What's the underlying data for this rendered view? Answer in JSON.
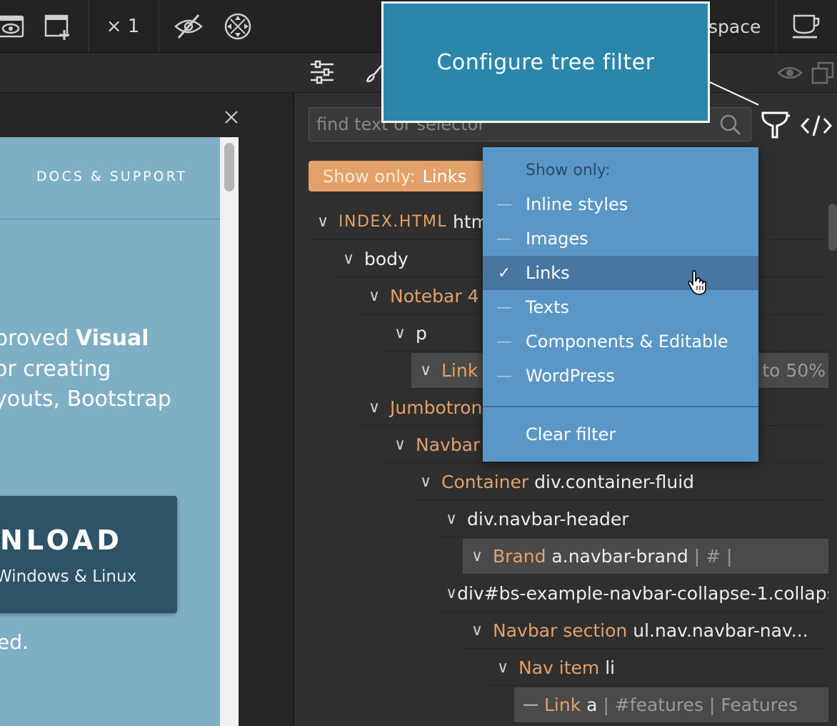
{
  "toolbar": {
    "zoom_label": "× 1",
    "workspace_label": "space"
  },
  "tooltip": {
    "text": "Configure tree filter"
  },
  "preview": {
    "docs_label": "DOCS & SUPPORT",
    "hero_line1_prefix": "proved ",
    "hero_line1_bold": "Visual",
    "hero_line2": "or creating",
    "hero_line3": "youts, Bootstrap",
    "download_label": "NLOAD",
    "download_sub": "Windows & Linux",
    "footer_text": "ed."
  },
  "search": {
    "placeholder": "find text or selector"
  },
  "filter_pill": {
    "key": "Show only:",
    "value": "Links"
  },
  "tree": {
    "root_name": "INDEX.HTML",
    "root_tag": "htm",
    "body": "body",
    "notebar_name": "Notebar 4",
    "p_tag": "p",
    "link1_name": "Link",
    "link1_trail": "p to 50%",
    "jumbotron_name": "Jumbotron",
    "navbar_name": "Navbar",
    "container_name": "Container",
    "container_tag": "div.container-fluid",
    "navbar_header": "div.navbar-header",
    "brand_name": "Brand",
    "brand_tag": "a.navbar-brand",
    "brand_sep1": "|",
    "brand_href": "#",
    "brand_sep2": "|",
    "collapse_tag": "div#bs-example-navbar-collapse-1.collaps",
    "navsection_name": "Navbar section",
    "navsection_tag": "ul.nav.navbar-nav...",
    "navitem_name": "Nav item",
    "navitem_tag": "li",
    "link2_name": "Link",
    "link2_tag": "a",
    "link2_sep1": "|",
    "link2_href": "#features",
    "link2_sep2": "|",
    "link2_text": "Features"
  },
  "dropdown": {
    "header": "Show only:",
    "items": [
      {
        "label": "Inline styles",
        "mark": "—"
      },
      {
        "label": "Images",
        "mark": "—"
      },
      {
        "label": "Links",
        "mark": "✓"
      },
      {
        "label": "Texts",
        "mark": "—"
      },
      {
        "label": "Components & Editable",
        "mark": "—"
      },
      {
        "label": "WordPress",
        "mark": "—"
      }
    ],
    "clear_label": "Clear filter"
  },
  "colors": {
    "accent_orange": "#e3a169",
    "dropdown_blue": "#5a97c6",
    "tooltip_blue": "#2a87ab"
  },
  "icons": [
    "preview-eye-icon",
    "new-page-icon",
    "hide-icon",
    "selector-target-icon",
    "coffee-cup-icon",
    "settings-sliders-icon",
    "brush-icon",
    "eye-icon",
    "duplicate-icon",
    "close-icon",
    "search-icon",
    "filter-funnel-icon",
    "code-icon",
    "mouse-pointer-hand-icon"
  ]
}
